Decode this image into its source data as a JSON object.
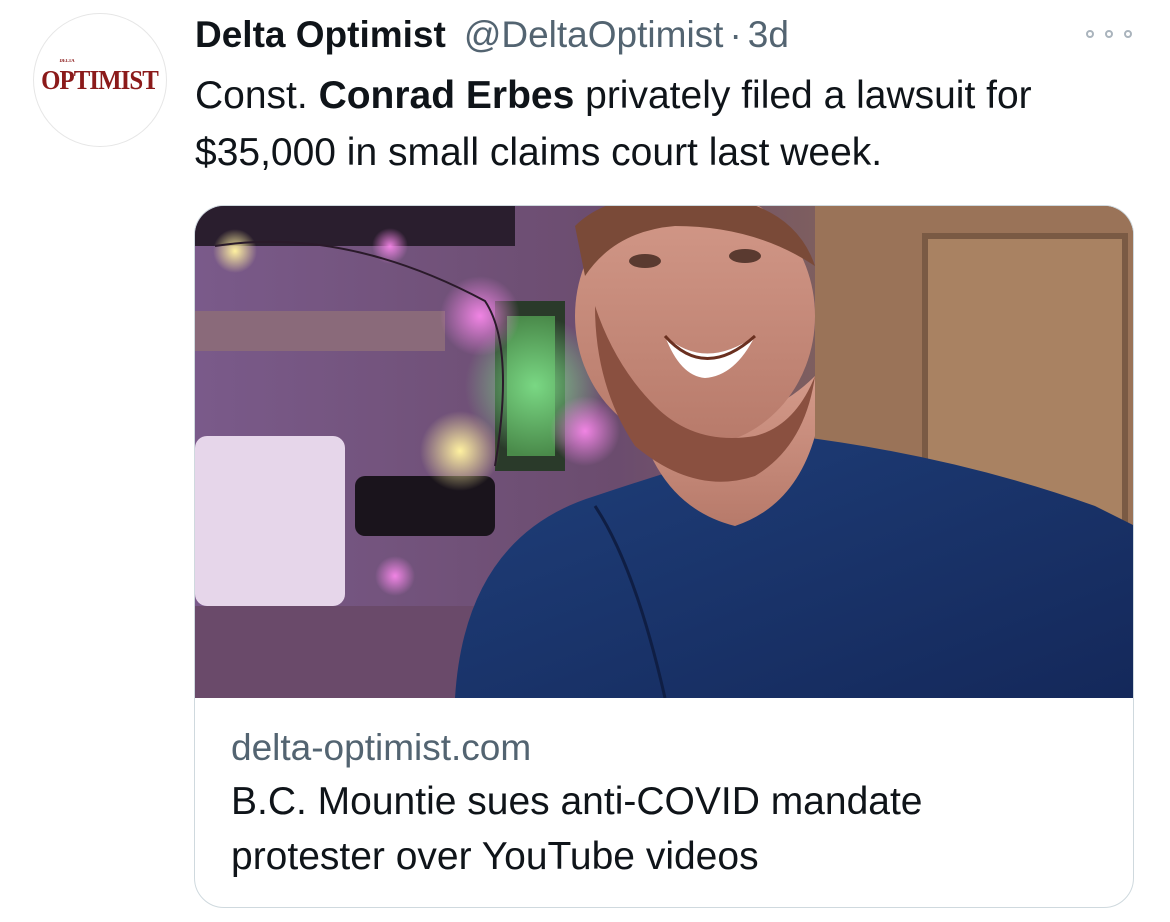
{
  "tweet": {
    "avatar_logo_text": "OPTIMIST",
    "avatar_logo_small": "DELTA",
    "author_name": "Delta Optimist",
    "handle": "@DeltaOptimist",
    "separator": "·",
    "time": "3d",
    "more_icon": "more-horizontal-icon",
    "text_part1": "Const. ",
    "text_bold": "Conrad Erbes",
    "text_part2": " privately filed a lawsuit for $35,000 in small claims court last week."
  },
  "card": {
    "domain": "delta-optimist.com",
    "title_line1": "B.C. Mountie sues anti-COVID mandate",
    "title_line2": "protester over YouTube videos"
  },
  "colors": {
    "secondary_text": "#536471",
    "primary_text": "#0f1419",
    "card_border": "#cfd9de",
    "logo_red": "#8b1a1a"
  }
}
